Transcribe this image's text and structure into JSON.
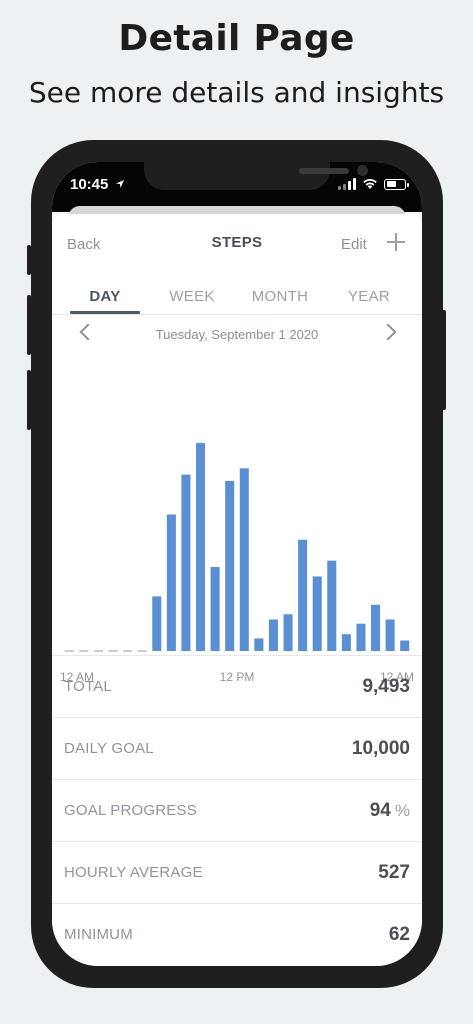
{
  "header": {
    "title": "Detail Page",
    "subtitle": "See more details and insights"
  },
  "statusbar": {
    "time": "10:45"
  },
  "nav": {
    "back_label": "Back",
    "title": "STEPS",
    "edit_label": "Edit",
    "add_icon": "plus-icon"
  },
  "tabs": [
    {
      "label": "DAY",
      "active": true
    },
    {
      "label": "WEEK",
      "active": false
    },
    {
      "label": "MONTH",
      "active": false
    },
    {
      "label": "YEAR",
      "active": false
    }
  ],
  "date_nav": {
    "date": "Tuesday, September 1 2020",
    "prev_icon": "chevron-left-icon",
    "next_icon": "chevron-right-icon"
  },
  "chart_data": {
    "type": "bar",
    "title": "",
    "x_tick_labels": [
      "12 AM",
      "12 PM",
      "12 AM"
    ],
    "categories": [
      "0",
      "1",
      "2",
      "3",
      "4",
      "5",
      "6",
      "7",
      "8",
      "9",
      "10",
      "11",
      "12",
      "13",
      "14",
      "15",
      "16",
      "17",
      "18",
      "19",
      "20",
      "21",
      "22",
      "23"
    ],
    "values": [
      0,
      0,
      0,
      0,
      0,
      0,
      260,
      650,
      840,
      990,
      400,
      810,
      870,
      60,
      150,
      175,
      530,
      355,
      430,
      80,
      130,
      220,
      150,
      50
    ],
    "ylim": [
      0,
      1000
    ],
    "bar_color": "#5b8fd3",
    "empty_dash_color": "#c9ccd1"
  },
  "stats": {
    "total": {
      "label": "TOTAL",
      "value": "9,493"
    },
    "daily_goal": {
      "label": "DAILY GOAL",
      "value": "10,000"
    },
    "goal_progress": {
      "label": "GOAL PROGRESS",
      "value": "94",
      "unit": "%"
    },
    "hourly_average": {
      "label": "HOURLY AVERAGE",
      "value": "527"
    },
    "minimum": {
      "label": "MINIMUM",
      "value": "62"
    }
  }
}
